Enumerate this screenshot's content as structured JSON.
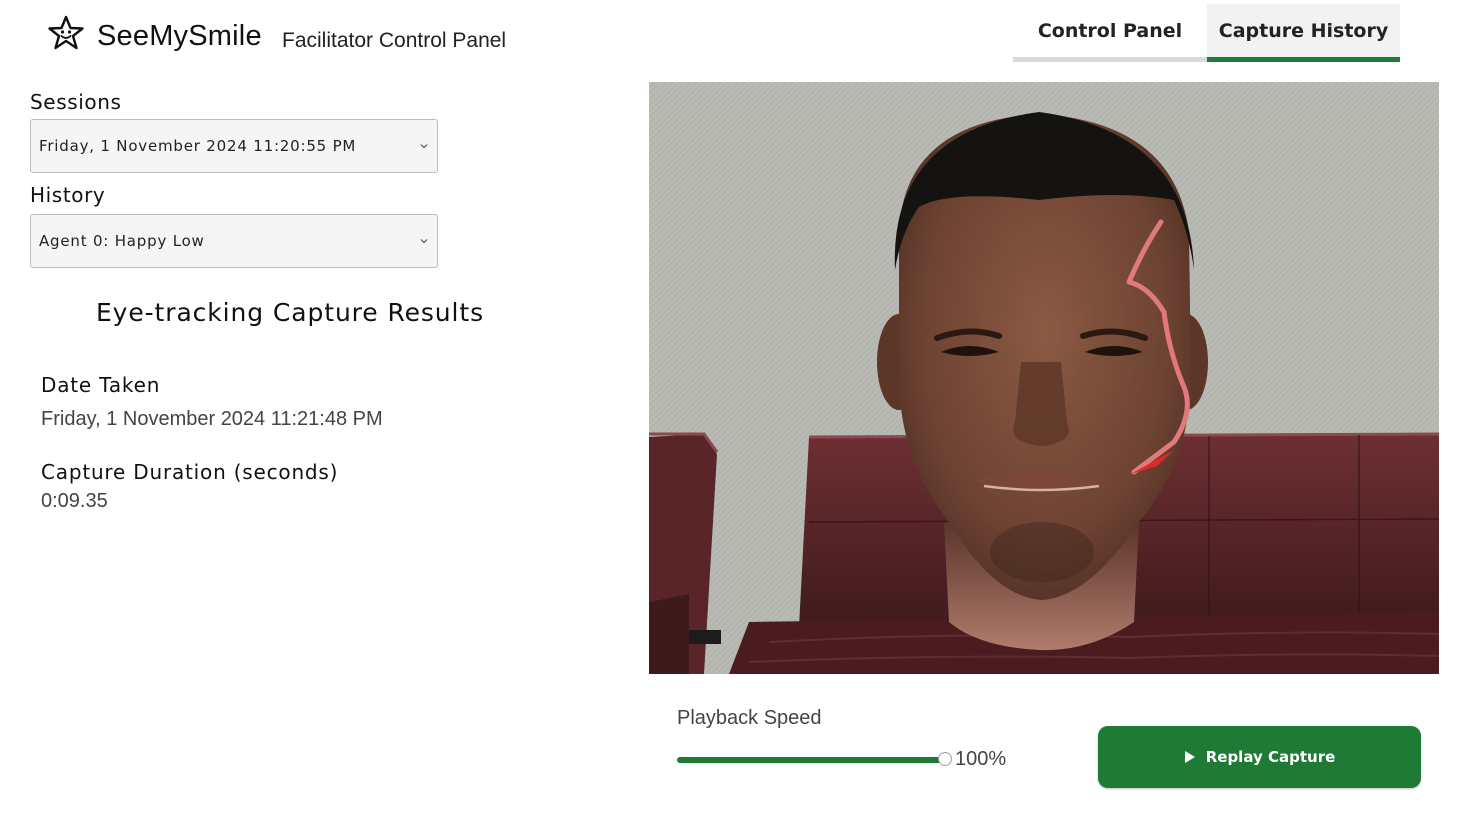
{
  "app": {
    "brand": "SeeMySmile",
    "subtitle": "Facilitator Control Panel",
    "logo_icon": "star-smile-icon"
  },
  "tabs": [
    {
      "label": "Control Panel",
      "active": false
    },
    {
      "label": "Capture History",
      "active": true
    }
  ],
  "sessions": {
    "label": "Sessions",
    "selected": "Friday, 1 November 2024 11:20:55 PM"
  },
  "history": {
    "label": "History",
    "selected": "Agent 0: Happy Low"
  },
  "results": {
    "title": "Eye-tracking Capture Results",
    "date_label": "Date Taken",
    "date_value": "Friday, 1 November 2024 11:21:48 PM",
    "duration_label": "Capture Duration (seconds)",
    "duration_value": "0:09.35"
  },
  "playback": {
    "label": "Playback Speed",
    "value_text": "100%",
    "level_fraction": 1.0,
    "button_label": "Replay Capture",
    "button_icon": "play-icon"
  },
  "colors": {
    "accent": "#1e7a34",
    "gaze_trail": "#e07a7a"
  }
}
